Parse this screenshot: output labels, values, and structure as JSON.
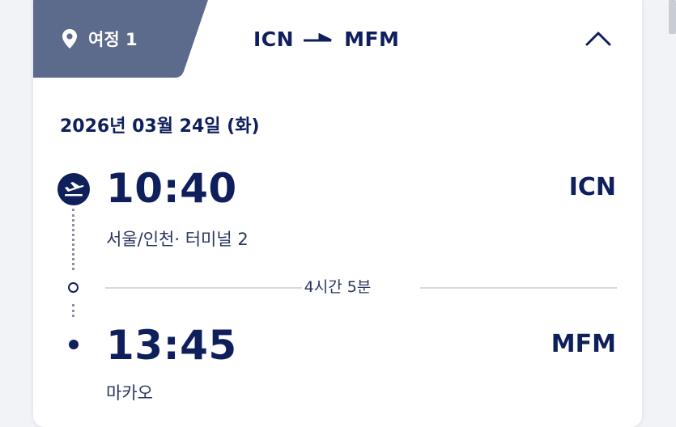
{
  "itinerary": {
    "tab_label": "여정 1",
    "origin_code": "ICN",
    "destination_code": "MFM",
    "collapse_icon": "chevron-up-icon",
    "date": "2026년 03월 24일 (화)"
  },
  "departure": {
    "time": "10:40",
    "code": "ICN",
    "place": "서울/인천· 터미널  2",
    "icon": "takeoff-icon"
  },
  "duration": "4시간 5분",
  "arrival": {
    "time": "13:45",
    "code": "MFM",
    "place": "마카오"
  },
  "colors": {
    "brand_navy": "#0f1f5c",
    "tab_slate": "#5c6a8c",
    "divider": "#d6d9e0"
  }
}
